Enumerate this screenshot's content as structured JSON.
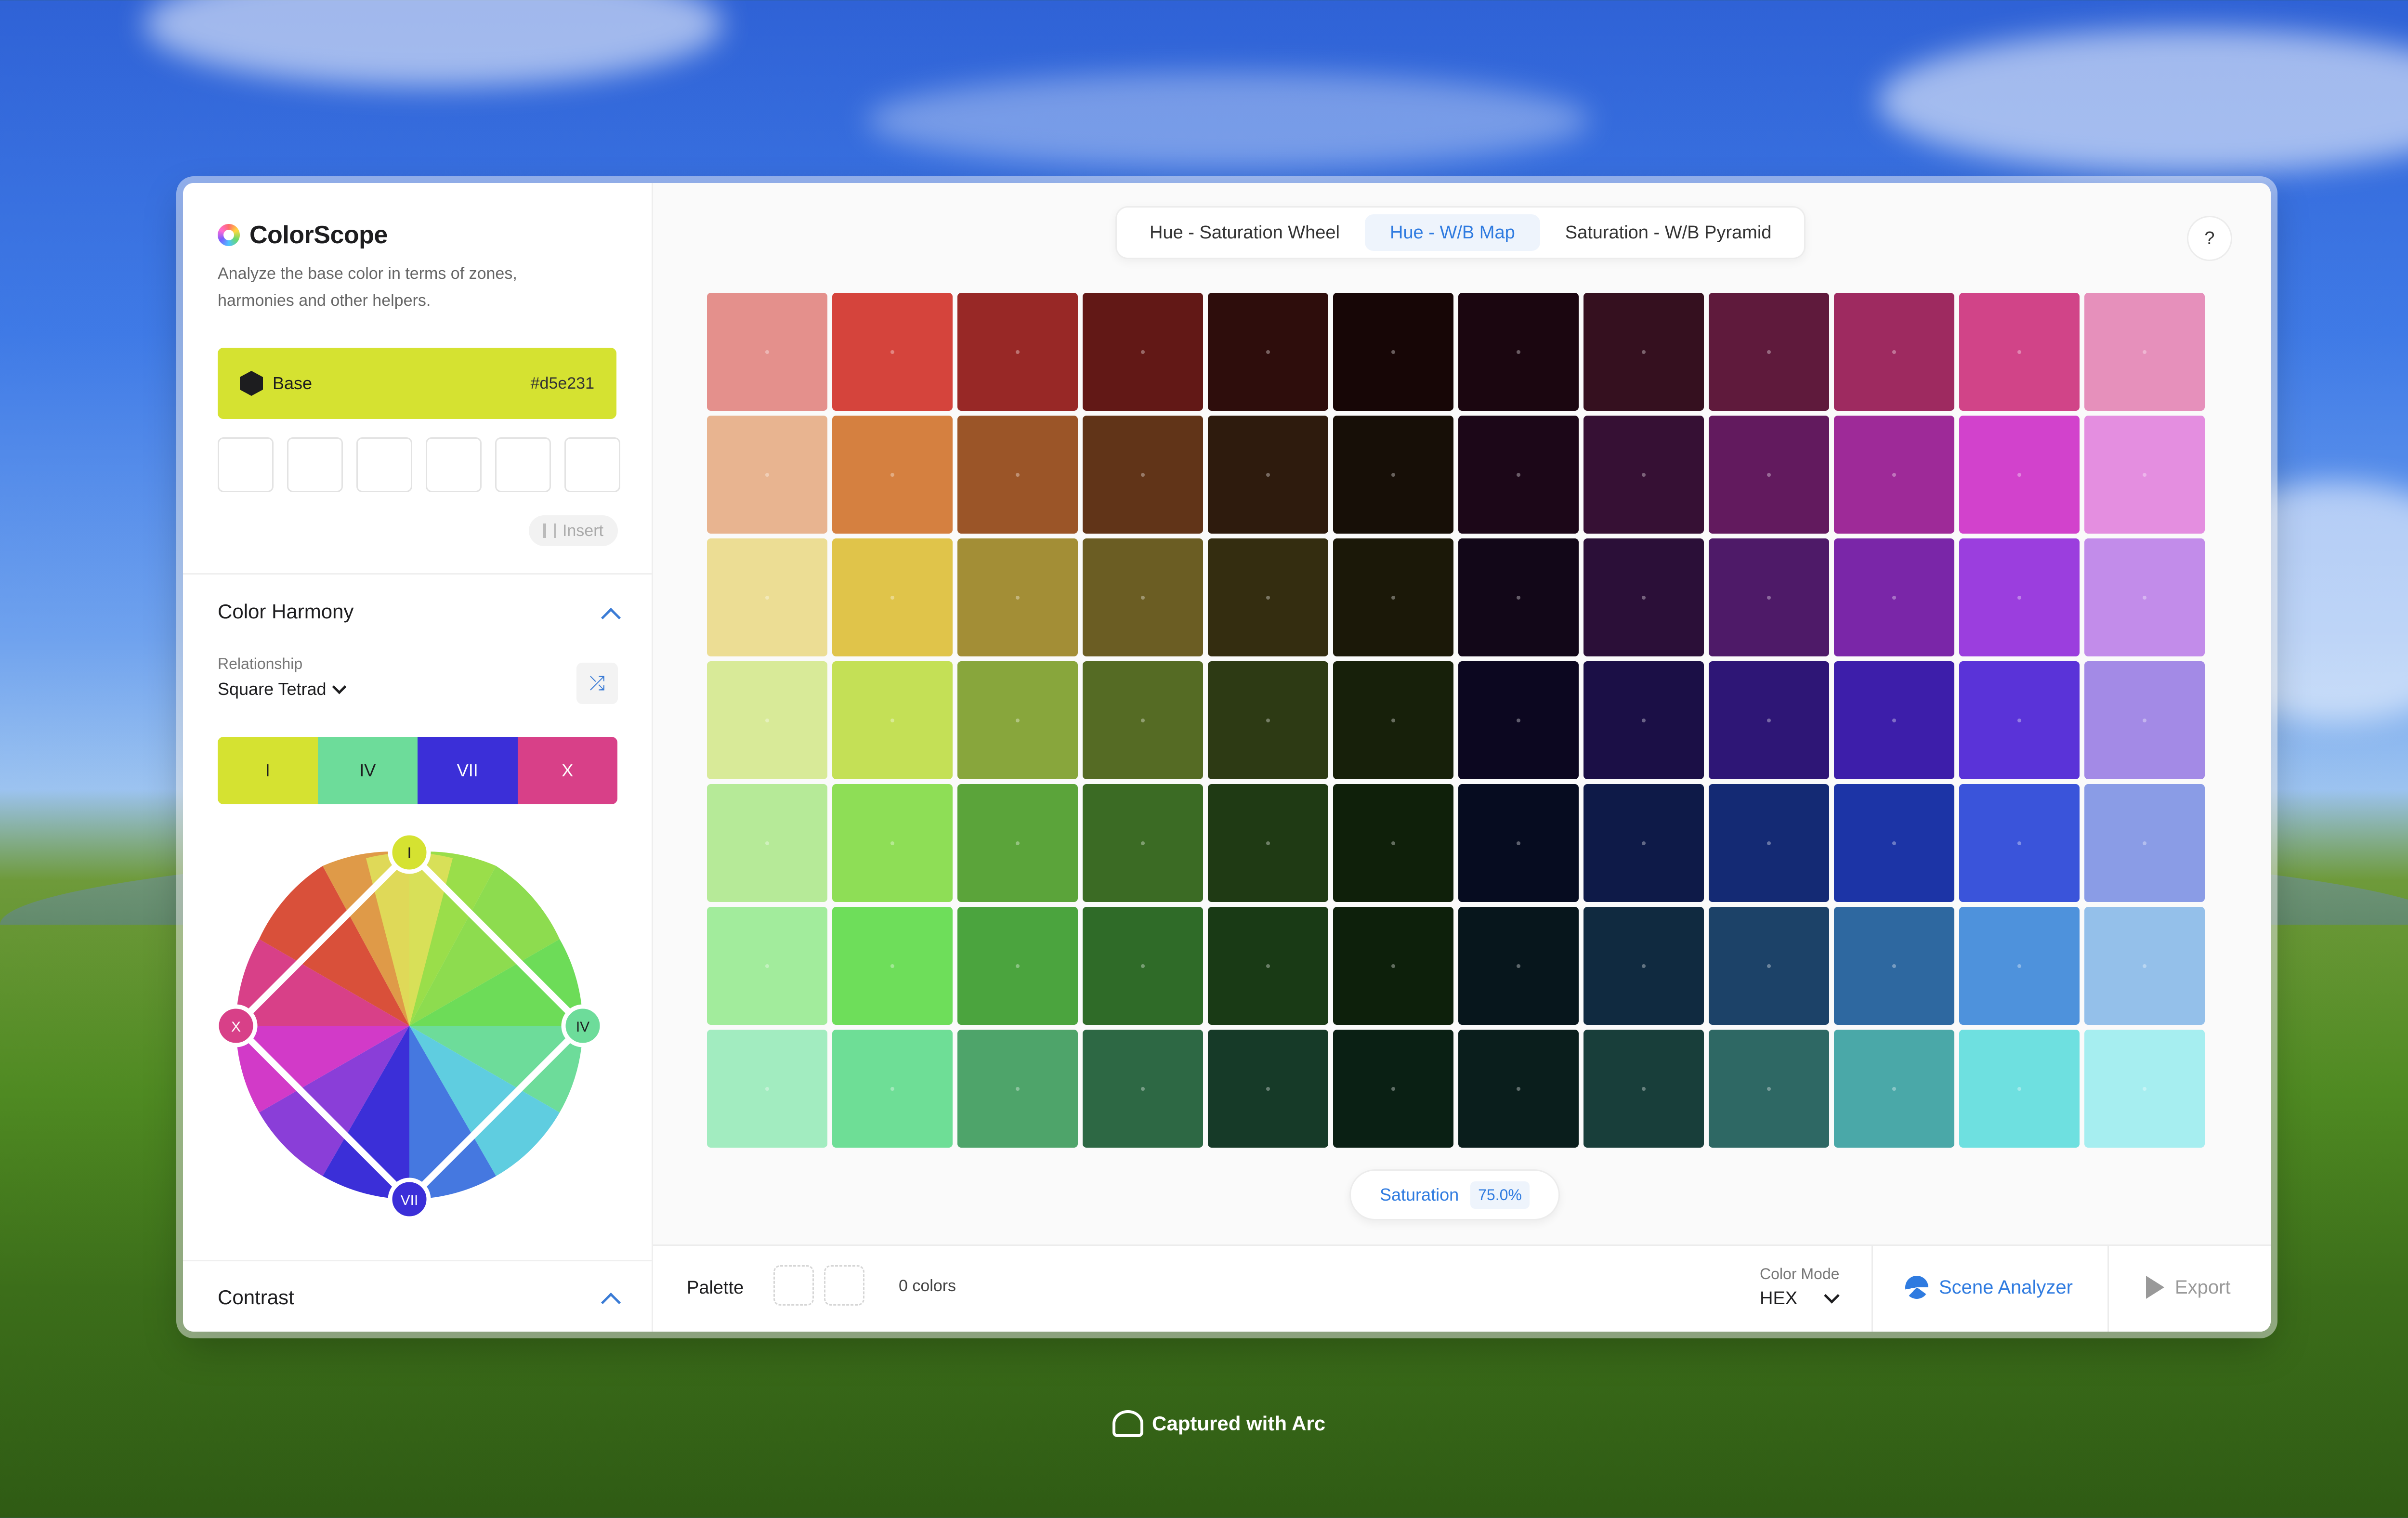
{
  "app": {
    "title": "ColorScope",
    "description": "Analyze the base color in terms of zones, harmonies and other helpers."
  },
  "base": {
    "label": "Base",
    "hex": "#d5e231",
    "color": "#d5e231"
  },
  "insert_label": "Insert",
  "color_harmony": {
    "title": "Color Harmony",
    "relationship_label": "Relationship",
    "relationship_value": "Square Tetrad",
    "harmony_colors": [
      {
        "label": "I",
        "color": "#d5e231"
      },
      {
        "label": "IV",
        "color": "#6ddc9a"
      },
      {
        "label": "VII",
        "color": "#3b2fd8"
      },
      {
        "label": "X",
        "color": "#d84088"
      }
    ],
    "wheel_markers": {
      "I": "I",
      "IV": "IV",
      "VII": "VII",
      "X": "X"
    }
  },
  "contrast": {
    "title": "Contrast"
  },
  "tabs": [
    {
      "label": "Hue - Saturation Wheel",
      "active": false
    },
    {
      "label": "Hue - W/B Map",
      "active": true
    },
    {
      "label": "Saturation - W/B Pyramid",
      "active": false
    }
  ],
  "help_label": "?",
  "color_grid": [
    [
      "#e4908c",
      "#d5443c",
      "#982826",
      "#621816",
      "#2e0d0c",
      "#170606",
      "#1b0610",
      "#35101f",
      "#5f1a3c",
      "#9e2a60",
      "#d14488",
      "#e690bb"
    ],
    [
      "#e8b490",
      "#d58040",
      "#9b5528",
      "#613418",
      "#2e1b0d",
      "#170f07",
      "#1c0718",
      "#361034",
      "#621a5e",
      "#9e2a98",
      "#d242cc",
      "#e48ee0"
    ],
    [
      "#ecdd94",
      "#e0c44a",
      "#a38e36",
      "#6b5d23",
      "#342d10",
      "#1b1808",
      "#120718",
      "#2b0f38",
      "#4e1a68",
      "#7a26a8",
      "#9b3ede",
      "#c28cea"
    ],
    [
      "#d8ea98",
      "#c4e056",
      "#88a63c",
      "#556b24",
      "#2d3a14",
      "#17200a",
      "#0c0720",
      "#1b0f46",
      "#2e1676",
      "#3d1eaa",
      "#5a33d8",
      "#a38ae6"
    ],
    [
      "#b6ea98",
      "#8ede56",
      "#5ba43a",
      "#3b6b24",
      "#1f3a14",
      "#0f200a",
      "#060c20",
      "#0e1a48",
      "#142a74",
      "#1c34a6",
      "#3a54da",
      "#8a9ce6"
    ],
    [
      "#a2ec9c",
      "#6ede5a",
      "#4ba43e",
      "#2f6b28",
      "#193a15",
      "#0d200b",
      "#07161c",
      "#102a40",
      "#1c4268",
      "#2e68a0",
      "#4e92dc",
      "#94c0ea"
    ],
    [
      "#a2ecc0",
      "#6ede96",
      "#4ea46a",
      "#2d6844",
      "#163a28",
      "#0a2014",
      "#0a1e1c",
      "#183e3a",
      "#2e6864",
      "#4aa8a8",
      "#6ee0e0",
      "#a6eef0"
    ]
  ],
  "saturation": {
    "label": "Saturation",
    "value": "75.0%"
  },
  "footer": {
    "palette_label": "Palette",
    "palette_count": "0 colors",
    "color_mode_label": "Color Mode",
    "color_mode_value": "HEX",
    "scene_analyzer_label": "Scene Analyzer",
    "export_label": "Export"
  },
  "watermark": "Captured with Arc"
}
